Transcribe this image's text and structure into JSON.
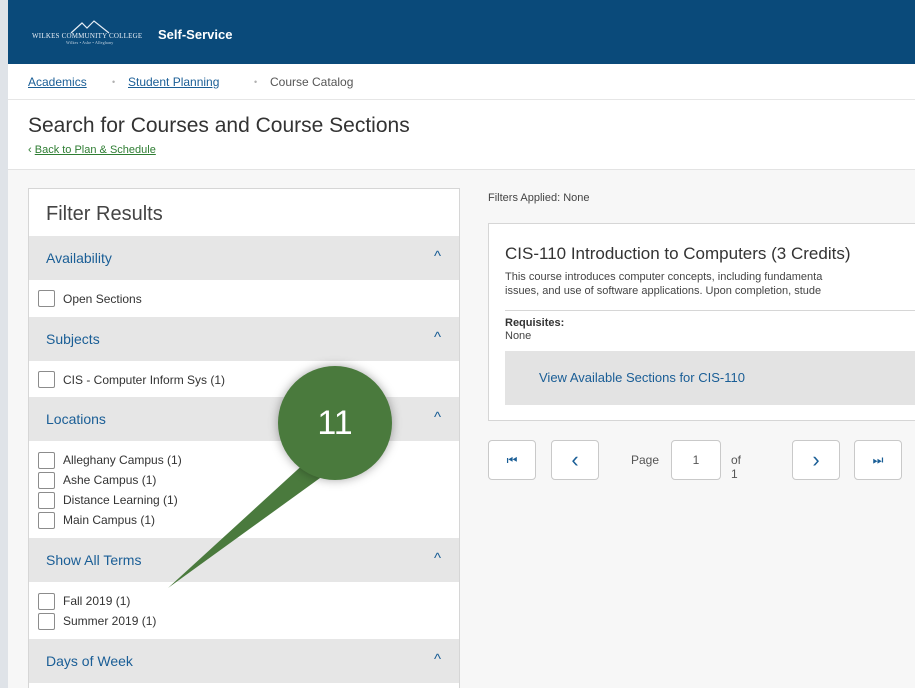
{
  "header": {
    "logo_text": "WILKES COMMUNITY COLLEGE",
    "logo_subtext": "Wilkes • Ashe • Alleghany",
    "app_title": "Self-Service"
  },
  "breadcrumb": {
    "items": [
      "Academics",
      "Student Planning",
      "Course Catalog"
    ],
    "separator": "•"
  },
  "page": {
    "title": "Search for Courses and Course Sections",
    "back_link": "Back to Plan & Schedule",
    "back_icon": "‹"
  },
  "filters": {
    "heading": "Filter Results",
    "collapse_icon": "^",
    "sections": [
      {
        "title": "Availability",
        "options": [
          "Open Sections"
        ]
      },
      {
        "title": "Subjects",
        "options": [
          "CIS - Computer Inform Sys (1)"
        ]
      },
      {
        "title": "Locations",
        "options": [
          "Alleghany Campus (1)",
          "Ashe Campus (1)",
          "Distance Learning (1)",
          "Main Campus (1)"
        ]
      },
      {
        "title": "Show All Terms",
        "options": [
          "Fall 2019 (1)",
          "Summer 2019 (1)"
        ]
      },
      {
        "title": "Days of Week",
        "options": []
      }
    ]
  },
  "results": {
    "filters_applied": "Filters Applied: None",
    "course": {
      "title": "CIS-110 Introduction to Computers (3 Credits)",
      "description_line1": "This course introduces computer concepts, including fundamenta",
      "description_line2": "issues, and use of software applications. Upon completion, stude",
      "requisites_label": "Requisites:",
      "requisites_value": "None",
      "view_sections_label": "View Available Sections for CIS-110"
    }
  },
  "pagination": {
    "page_label": "Page",
    "page_value": "1",
    "of_label": "of 1",
    "first_icon": "⏮",
    "prev_icon": "‹",
    "next_icon": "›",
    "last_icon": "⏭"
  },
  "annotation": {
    "step_number": "11",
    "color": "#4a7a3d"
  }
}
